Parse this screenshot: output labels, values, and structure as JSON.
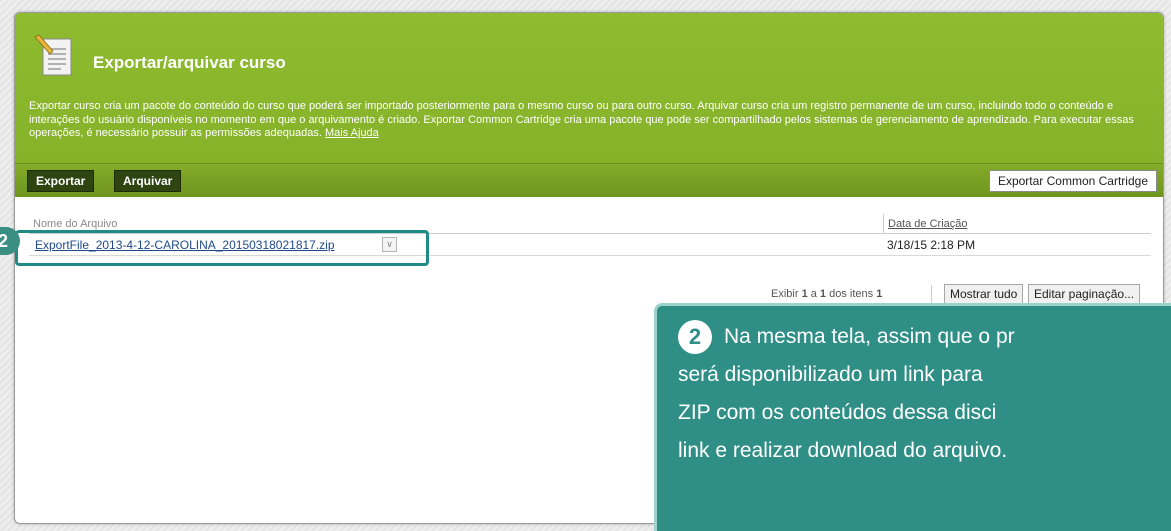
{
  "header": {
    "title": "Exportar/arquivar curso",
    "description": "Exportar curso cria um pacote do conteúdo do curso que poderá ser importado posteriormente para o mesmo curso ou para outro curso. Arquivar curso cria um registro permanente de um curso, incluindo todo o conteúdo e interações do usuário disponíveis no momento em que o arquivamento é criado. Exportar Common Cartridge cria uma pacote que pode ser compartilhado pelos sistemas de gerenciamento de aprendizado. Para executar essas operações, é necessário possuir as permissões adequadas.",
    "help_link": "Mais Ajuda"
  },
  "actions": {
    "export": "Exportar",
    "archive": "Arquivar",
    "export_cc": "Exportar Common Cartridge"
  },
  "table": {
    "col_name": "Nome do Arquivo",
    "col_date": "Data de Criação",
    "rows": [
      {
        "name": "ExportFile_2013-4-12-CAROLINA_20150318021817.zip",
        "date": "3/18/15 2:18 PM"
      }
    ]
  },
  "pager": {
    "prefix": "Exibir ",
    "from": "1",
    "middle1": " a ",
    "to": "1",
    "middle2": " dos itens ",
    "total": "1",
    "show_all": "Mostrar tudo",
    "edit_paging": "Editar paginação..."
  },
  "annotation": {
    "badge_number": "2",
    "lines": [
      "Na mesma tela, assim que o pr",
      "será disponibilizado um link para",
      "ZIP com os conteúdos dessa disci",
      "link e realizar download do arquivo."
    ]
  },
  "colors": {
    "header_green": "#8fbb30",
    "action_dark": "#2e4411",
    "callout_teal": "#2f8f86"
  }
}
